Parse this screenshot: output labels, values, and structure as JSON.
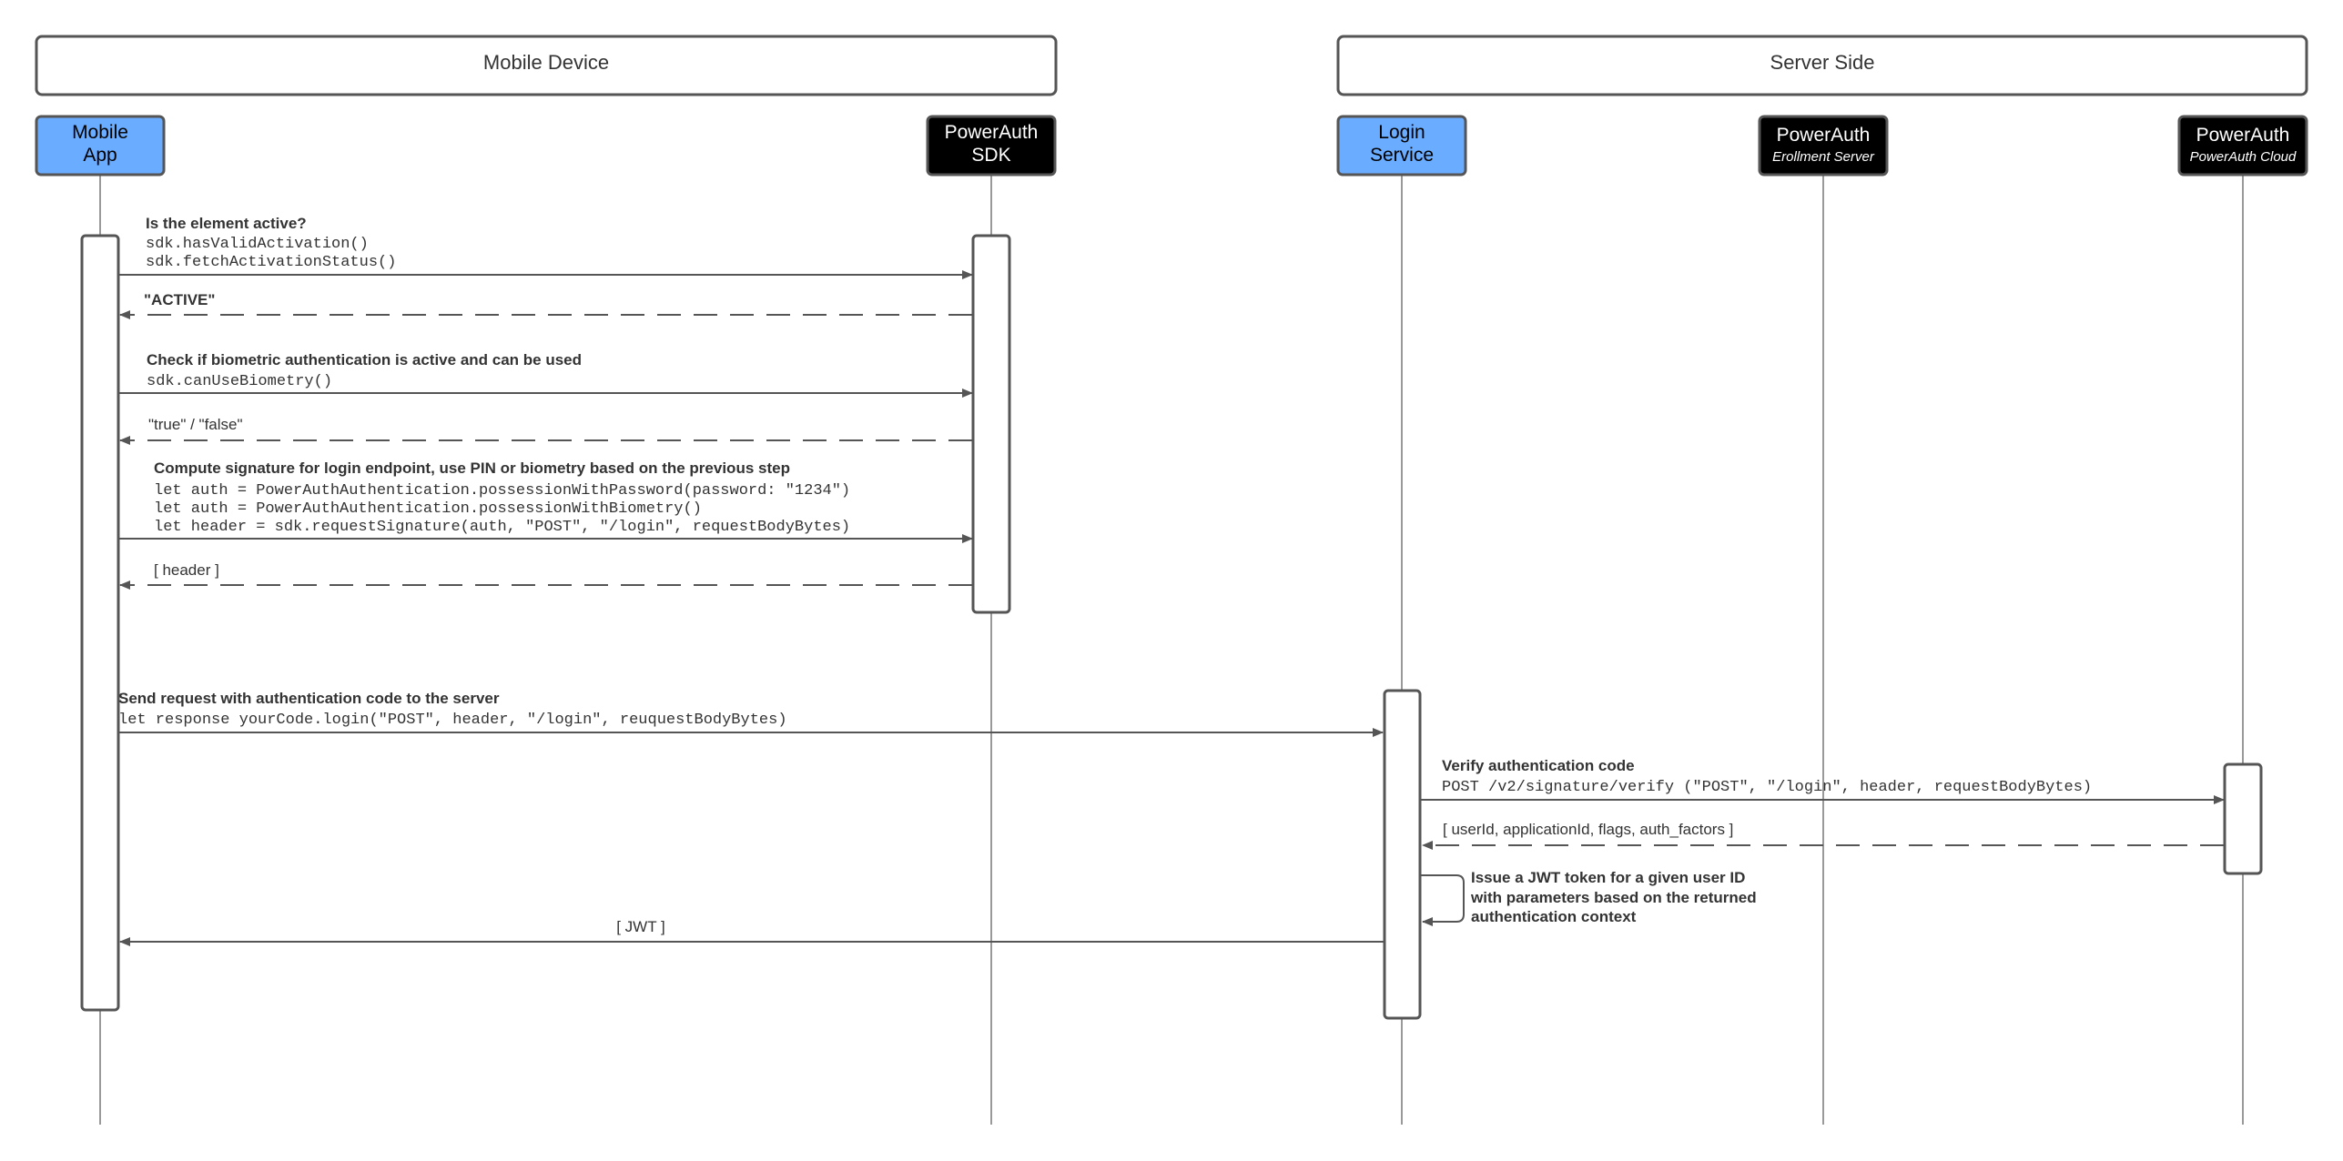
{
  "groups": {
    "mobile_device": "Mobile Device",
    "server_side": "Server Side"
  },
  "participants": {
    "mobile_app": {
      "line1": "Mobile",
      "line2": "App"
    },
    "sdk": {
      "line1": "PowerAuth",
      "line2": "SDK"
    },
    "login_service": {
      "line1": "Login",
      "line2": "Service"
    },
    "enrollment_server": {
      "title": "PowerAuth",
      "subtitle": "Erollment Server"
    },
    "cloud": {
      "title": "PowerAuth",
      "subtitle": "PowerAuth Cloud"
    }
  },
  "messages": {
    "m1": {
      "title": "Is the element active?",
      "code1": "sdk.hasValidActivation()",
      "code2": "sdk.fetchActivationStatus()"
    },
    "r1": {
      "label": "\"ACTIVE\""
    },
    "m2": {
      "title": "Check if biometric authentication is active and can be used",
      "code1": "sdk.canUseBiometry()"
    },
    "r2": {
      "label": "\"true\" / \"false\""
    },
    "m3": {
      "title": "Compute signature for login endpoint, use PIN or biometry based on the previous step",
      "code1": "let auth = PowerAuthAuthentication.possessionWithPassword(password: \"1234\")",
      "code2": "let auth = PowerAuthAuthentication.possessionWithBiometry()",
      "code3": "let header = sdk.requestSignature(auth, \"POST\", \"/login\", requestBodyBytes)"
    },
    "r3": {
      "label": "[ header ]"
    },
    "m4": {
      "title": "Send request with authentication code to the server",
      "code1": "let response yourCode.login(\"POST\", header, \"/login\", reuquestBodyBytes)"
    },
    "m5": {
      "title": "Verify authentication code",
      "code1": "POST /v2/signature/verify (\"POST\", \"/login\", header, requestBodyBytes)"
    },
    "r5": {
      "label": "[ userId, applicationId, flags, auth_factors ]"
    },
    "self": {
      "line1": "Issue a JWT token for a given user ID",
      "line2": "with parameters based on the returned",
      "line3": "authentication context"
    },
    "r4": {
      "label": "[ JWT ]"
    }
  },
  "colors": {
    "client_participant": "#6aacff",
    "server_participant": "#000000",
    "line": "#555555",
    "text": "#333333"
  }
}
